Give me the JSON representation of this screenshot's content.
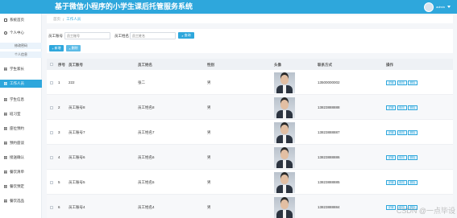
{
  "header": {
    "title": "基于微信小程序的小学生课后托管服务系统",
    "admin_name": "admin"
  },
  "sidebar": {
    "items": [
      {
        "label": "系统首页",
        "icon": "home-icon"
      },
      {
        "label": "个人中心",
        "icon": "user-icon"
      },
      {
        "label": "修改密码"
      },
      {
        "label": "个人信息"
      },
      {
        "label": "学生家长",
        "icon": "grid-icon"
      },
      {
        "label": "工作人员",
        "icon": "grid-icon"
      },
      {
        "label": "学生信息",
        "icon": "grid-icon"
      },
      {
        "label": "班习室",
        "icon": "grid-icon"
      },
      {
        "label": "座位预约",
        "icon": "grid-icon"
      },
      {
        "label": "预约座谈",
        "icon": "grid-icon"
      },
      {
        "label": "接送确认",
        "icon": "grid-icon"
      },
      {
        "label": "餐饮清单",
        "icon": "grid-icon"
      },
      {
        "label": "餐饮预定",
        "icon": "grid-icon"
      },
      {
        "label": "餐饮选品",
        "icon": "grid-icon"
      }
    ]
  },
  "breadcrumb": {
    "home": "首页",
    "separator": "/",
    "current": "工作人员"
  },
  "filter": {
    "label_id": "员工账号",
    "placeholder_id": "员工账号",
    "label_name": "员工姓名",
    "placeholder_name": "员工姓名",
    "search_label": "查询",
    "add_label": "新增",
    "delete_label": "删除"
  },
  "table": {
    "columns": [
      "序号",
      "员工账号",
      "员工姓名",
      "性别",
      "头像",
      "联系方式",
      "操作"
    ],
    "rows": [
      {
        "index": "1",
        "account": "222",
        "name": "张二",
        "gender": "男",
        "phone": "13500000002"
      },
      {
        "index": "2",
        "account": "员工账号8",
        "name": "员工姓名8",
        "gender": "男",
        "phone": "13823888888"
      },
      {
        "index": "3",
        "account": "员工账号7",
        "name": "员工姓名7",
        "gender": "男",
        "phone": "13823888887"
      },
      {
        "index": "4",
        "account": "员工账号6",
        "name": "员工姓名6",
        "gender": "男",
        "phone": "13823888886"
      },
      {
        "index": "5",
        "account": "员工账号5",
        "name": "员工姓名5",
        "gender": "男",
        "phone": "13823888885"
      },
      {
        "index": "6",
        "account": "员工账号4",
        "name": "员工姓名4",
        "gender": "男",
        "phone": "13823888884"
      }
    ],
    "actions": {
      "detail": "详情",
      "edit": "修改",
      "delete": "删除"
    }
  },
  "watermark": "CSDN @一点毕设",
  "colors": {
    "accent": "#2ea7dc",
    "header_bg": "#2ea7dc"
  }
}
